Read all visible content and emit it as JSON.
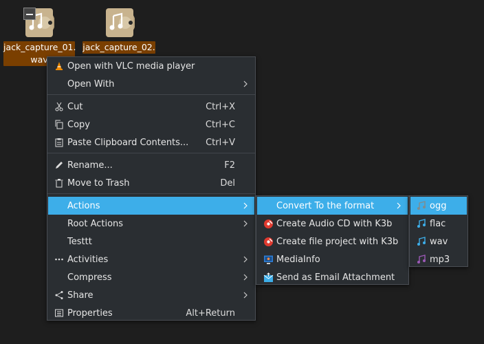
{
  "desktop": {
    "files": [
      {
        "name_line1": "jack_capture_01.",
        "name_line2": "wav"
      },
      {
        "name_line1": "jack_capture_02.",
        "name_line2": ""
      }
    ]
  },
  "context_menu": {
    "items": [
      {
        "label": "Open with VLC media player",
        "icon": "vlc-cone-icon"
      },
      {
        "label": "Open With",
        "submenu": true
      },
      {
        "label": "Cut",
        "shortcut": "Ctrl+X",
        "icon": "scissors-icon"
      },
      {
        "label": "Copy",
        "shortcut": "Ctrl+C",
        "icon": "copy-icon"
      },
      {
        "label": "Paste Clipboard Contents...",
        "shortcut": "Ctrl+V",
        "icon": "clipboard-icon"
      },
      {
        "label": "Rename...",
        "shortcut": "F2",
        "icon": "pencil-icon"
      },
      {
        "label": "Move to Trash",
        "shortcut": "Del",
        "icon": "trash-icon"
      },
      {
        "label": "Actions",
        "submenu": true,
        "highlighted": true
      },
      {
        "label": "Root Actions",
        "submenu": true
      },
      {
        "label": "Testtt"
      },
      {
        "label": "Activities",
        "submenu": true,
        "icon": "dots-icon"
      },
      {
        "label": "Compress",
        "submenu": true
      },
      {
        "label": "Share",
        "submenu": true,
        "icon": "share-icon"
      },
      {
        "label": "Properties",
        "shortcut": "Alt+Return",
        "icon": "properties-icon"
      }
    ]
  },
  "actions_menu": {
    "items": [
      {
        "label": "Convert To the format",
        "submenu": true,
        "highlighted": true
      },
      {
        "label": "Create Audio CD with K3b",
        "icon": "k3b-icon"
      },
      {
        "label": "Create file project with K3b",
        "icon": "k3b-icon"
      },
      {
        "label": "MediaInfo",
        "icon": "mediainfo-icon"
      },
      {
        "label": "Send as Email Attachment",
        "icon": "email-icon"
      }
    ]
  },
  "format_menu": {
    "items": [
      {
        "label": "ogg",
        "icon": "music-note-icon",
        "highlighted": true
      },
      {
        "label": "flac",
        "icon": "music-note-icon"
      },
      {
        "label": "wav",
        "icon": "music-note-icon"
      },
      {
        "label": "mp3",
        "icon": "music-note-icon"
      }
    ]
  },
  "colors": {
    "highlight": "#3daee9",
    "menu_bg": "#2a2e32",
    "selection_label": "#7a3f00",
    "note_blue": "#3daee9",
    "note_purple": "#9b59b6",
    "note_gray": "#7f8c8d"
  }
}
